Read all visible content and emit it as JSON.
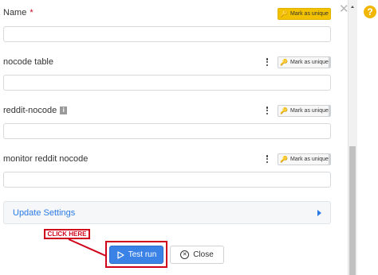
{
  "fields": [
    {
      "label": "Name",
      "required_mark": "*",
      "unique_label": "Mark as unique",
      "unique_active": true,
      "has_menu": false,
      "has_info": false
    },
    {
      "label": "nocode table",
      "unique_label": "Mark as unique",
      "unique_active": false,
      "has_menu": true,
      "has_info": false
    },
    {
      "label": "reddit-nocode",
      "unique_label": "Mark as unique",
      "unique_active": false,
      "has_menu": true,
      "has_info": true
    },
    {
      "label": "monitor reddit nocode",
      "unique_label": "Mark as unique",
      "unique_active": false,
      "has_menu": true,
      "has_info": false
    }
  ],
  "accordion": {
    "title": "Update Settings"
  },
  "annotation": {
    "callout": "CLICK HERE"
  },
  "actions": {
    "test_run_label": "Test run",
    "close_label": "Close"
  },
  "icons": {
    "key": "key-icon",
    "more": "kebab-menu-icon",
    "info": "info-icon",
    "play": "play-icon",
    "close": "close-circle-icon",
    "dismiss": "close-icon",
    "help": "help-icon"
  },
  "colors": {
    "accent": "#3b82e6",
    "unique_active": "#f2c200",
    "annotation": "#d0021b",
    "help": "#f2b705"
  }
}
